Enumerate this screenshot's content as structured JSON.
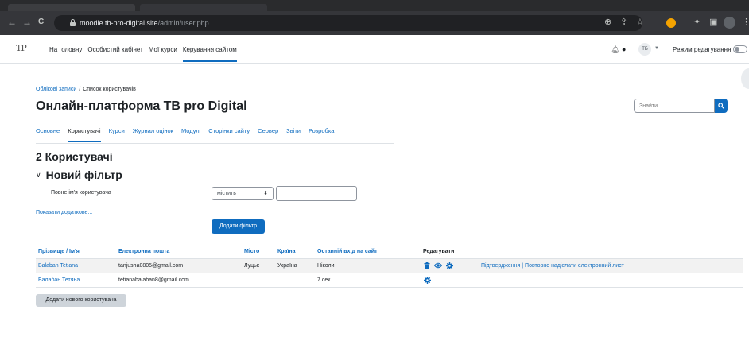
{
  "browser": {
    "url_host": "moodle.tb-pro-digital.site",
    "url_path": "/admin/user.php",
    "nav": {
      "back": "←",
      "forward": "→",
      "reload": "C"
    },
    "toolbar_icons": [
      "zoom-icon",
      "share-icon",
      "star-icon",
      "extensions-icon",
      "sidepanel-icon",
      "profile-icon",
      "menu-icon"
    ]
  },
  "navbar": {
    "logo": "TP",
    "items": [
      "На головну",
      "Особистий кабінет",
      "Мої курси",
      "Керування сайтом"
    ],
    "active_index": 3,
    "user_initials": "TБ",
    "edit_mode_label": "Режим редагування"
  },
  "page": {
    "breadcrumb": [
      "Облікові записи",
      "Список користувачів"
    ],
    "title": "Онлайн-платформа TB pro Digital",
    "search_placeholder": "Знайти",
    "secondary_nav": [
      "Основне",
      "Користувачі",
      "Курси",
      "Журнал оцінок",
      "Модулі",
      "Сторінки сайту",
      "Сервер",
      "Звіти",
      "Розробка"
    ],
    "secondary_active_index": 1,
    "users_heading": "2 Користувачі",
    "filter_heading": "Новий фільтр",
    "filter_field_label": "Повне ім'я користувача",
    "filter_operator": "містить",
    "show_more": "Показати додаткове...",
    "add_filter_button": "Додати фільтр",
    "add_user_button": "Додати нового користувача"
  },
  "table": {
    "columns": [
      "Прізвище / Ім'я",
      "Електронна пошта",
      "Місто",
      "Країна",
      "Останній вхід на сайт",
      "Редагувати"
    ],
    "rows": [
      {
        "name": "Balaban Tetiana",
        "email": "tanjusha0805@gmail.com",
        "city": "Луцьк",
        "country": "Україна",
        "last_access": "Ніколи",
        "actions": [
          "delete-icon",
          "suspend-eye-icon",
          "settings-icon"
        ],
        "extra": "Підтвердження | Повторно надіслати електронний лист"
      },
      {
        "name": "Балабан Тетяна",
        "email": "tetianabalaban8@gmail.com",
        "city": "",
        "country": "",
        "last_access": "7 сек",
        "actions": [
          "settings-icon"
        ],
        "extra": ""
      }
    ]
  },
  "colors": {
    "accent": "#0f6cbf",
    "row_stripe": "#f2f2f2",
    "chrome": "#35363a"
  }
}
